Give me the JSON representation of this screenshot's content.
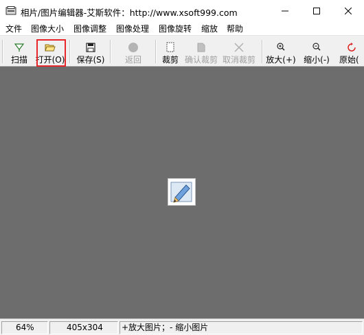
{
  "window": {
    "title": "相片/图片编辑器-艾斯软件：http://www.xsoft999.com",
    "controls": [
      "minimize",
      "maximize",
      "close"
    ]
  },
  "menu": {
    "items": [
      {
        "label": "文件"
      },
      {
        "label": "图像大小"
      },
      {
        "label": "图像调整"
      },
      {
        "label": "图像处理"
      },
      {
        "label": "图像旋转"
      },
      {
        "label": "缩放"
      },
      {
        "label": "帮助"
      }
    ]
  },
  "toolbar": {
    "buttons": [
      {
        "label": "扫描",
        "icon": "scan-icon",
        "enabled": true
      },
      {
        "label": "打开(O)",
        "icon": "open-folder-icon",
        "enabled": true,
        "highlighted": true
      },
      {
        "label": "保存(S)",
        "icon": "save-disk-icon",
        "enabled": true
      },
      {
        "label": "返回",
        "icon": "undo-icon",
        "enabled": false
      },
      {
        "label": "裁剪",
        "icon": "crop-icon",
        "enabled": true
      },
      {
        "label": "确认裁剪",
        "icon": "confirm-crop-icon",
        "enabled": false
      },
      {
        "label": "取消裁剪",
        "icon": "cancel-crop-icon",
        "enabled": false
      },
      {
        "label": "放大(+)",
        "icon": "zoom-in-icon",
        "enabled": true
      },
      {
        "label": "缩小(-)",
        "icon": "zoom-out-icon",
        "enabled": true
      },
      {
        "label": "原始(",
        "icon": "original-size-icon",
        "enabled": true
      }
    ],
    "highlight_color": "#e8262a"
  },
  "canvas": {
    "background": "#6d6d6d",
    "placeholder_icon": "edit-pencil-icon"
  },
  "status": {
    "zoom": "64%",
    "dimensions": "405x304",
    "hint": "+放大图片；- 缩小图片"
  }
}
